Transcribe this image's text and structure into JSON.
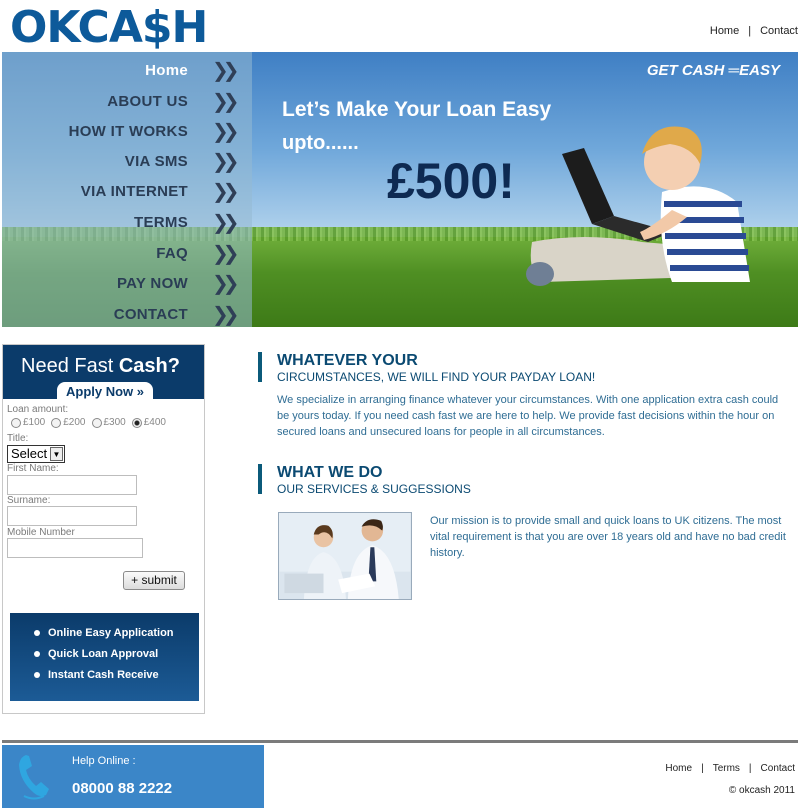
{
  "header": {
    "logo": "OKCA$H",
    "links": [
      "Home",
      "Contact"
    ]
  },
  "banner": {
    "nav": [
      "Home",
      "ABOUT US",
      "HOW IT WORKS",
      "VIA SMS",
      "VIA INTERNET",
      "TERMS",
      "FAQ",
      "PAY NOW",
      "CONTACT"
    ],
    "chevron": "❯❯",
    "tagline": "Let’s Make Your Loan Easy",
    "upto": "upto......",
    "amount": "£500!",
    "slogan": "GET CASH ═EASY"
  },
  "form": {
    "title_a": "Need Fast ",
    "title_b": "Cash?",
    "apply": "Apply Now »",
    "loan_label": "Loan amount:",
    "amounts": [
      "£100",
      "£200",
      "£300",
      "£400"
    ],
    "selected_amount": "£400",
    "title_label": "Title:",
    "title_select": "Select",
    "first_label": "First Name:",
    "surname_label": "Surname:",
    "mobile_label": "Mobile Number",
    "submit": "+ submit",
    "features": [
      "Online Easy Application",
      "Quick Loan Approval",
      "Instant Cash Receive"
    ]
  },
  "main": {
    "s1_title": "WHATEVER YOUR",
    "s1_sub": "CIRCUMSTANCES, WE WILL FIND YOUR PAYDAY LOAN!",
    "s1_text": "We specialize in arranging finance whatever your circumstances. With one application extra cash could be yours today. If you need cash fast we are here to help. We provide fast decisions within the hour on secured loans and unsecured loans for people in all circumstances.",
    "s2_title": "WHAT WE DO",
    "s2_sub": "OUR SERVICES & SUGGESSIONS",
    "s2_text": "Our mission is to provide small and quick loans to UK citizens. The most vital requirement is that you are over 18 years old and have no bad credit history."
  },
  "footer": {
    "help_label": "Help Online :",
    "phone": "08000 88 2222",
    "links": [
      "Home",
      "Terms",
      "Contact"
    ],
    "copyright": "© okcash 2011"
  },
  "colors": {
    "brand": "#0d5a9a",
    "navy": "#0b3b6a",
    "help_blue": "#3b86c8"
  }
}
